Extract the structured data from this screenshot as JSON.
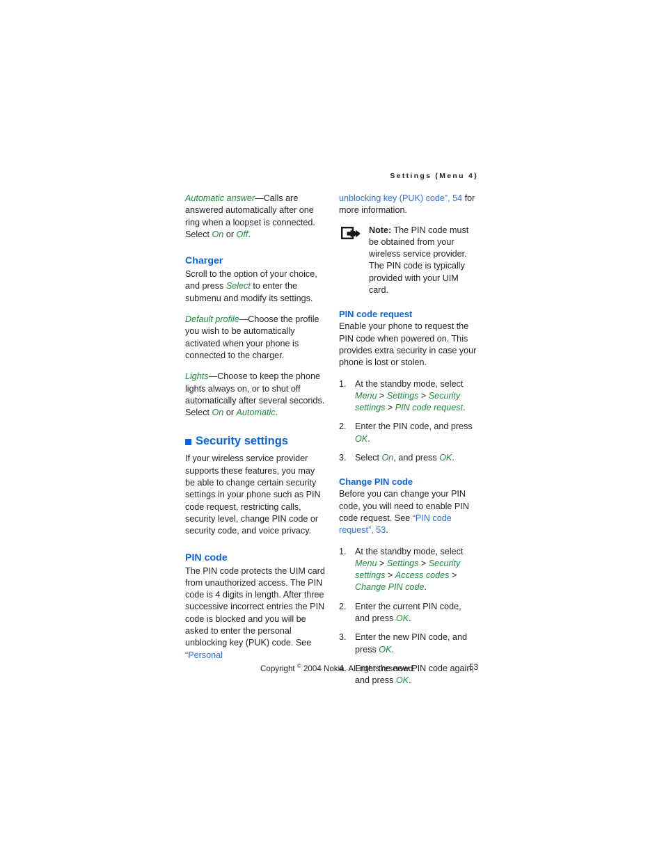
{
  "header": {
    "running_head": "Settings (Menu 4)"
  },
  "colors": {
    "heading_blue": "#0a64dc",
    "link_blue": "#2f6fd0",
    "emphasis_green": "#1d8a3e",
    "body_text": "#231f20",
    "page_background": "#ffffff"
  },
  "left_column": {
    "automatic_answer": {
      "term": "Automatic answer",
      "text_1": "—Calls are answered automatically after one ring when a loopset is connected. Select ",
      "opt_1": "On",
      "text_2": " or ",
      "opt_2": "Off",
      "text_3": "."
    },
    "charger_heading": "Charger",
    "charger_intro_1": "Scroll to the option of your choice, and press ",
    "charger_intro_em": "Select",
    "charger_intro_2": " to enter the submenu and modify its settings.",
    "default_profile": {
      "term": "Default profile",
      "text": "—Choose the profile you wish to be automatically activated when your phone is connected to the charger."
    },
    "lights": {
      "term": "Lights",
      "text_1": "—Choose to keep the phone lights always on, or to shut off automatically after several seconds. Select ",
      "opt_1": "On",
      "text_2": " or ",
      "opt_2": "Automatic",
      "text_3": "."
    },
    "security_settings_heading": "Security settings",
    "security_settings_body": "If your wireless service provider supports these features, you may be able to change certain security settings in your phone such as PIN code request, restricting calls, security level, change PIN code or security code, and voice privacy.",
    "pin_code_heading": "PIN code",
    "pin_code_body_1": "The PIN code protects the UIM card from unauthorized access. The PIN code is 4 digits in length. After three successive incorrect entries the PIN code is blocked and you will be asked to enter the personal unblocking key (PUK) code. See ",
    "pin_code_link": "“Personal"
  },
  "right_column": {
    "continuation_link": "unblocking key (PUK) code”, 54",
    "continuation_text": " for more information.",
    "note": {
      "icon": "note-hand-pointer-icon",
      "label": "Note:",
      "text": " The PIN code must be obtained from your wireless service provider. The PIN code is typically provided with your UIM card."
    },
    "pin_code_request_heading": "PIN code request",
    "pin_code_request_body": "Enable your phone to request the PIN code when powered on. This provides extra security in case your phone is lost or stolen.",
    "pin_code_request_steps": [
      {
        "prefix": "At the standby mode, select ",
        "path": [
          "Menu",
          "Settings",
          "Security settings",
          "PIN code request"
        ],
        "suffix": "."
      },
      {
        "prefix": "Enter the PIN code, and press ",
        "key": "OK",
        "suffix": "."
      },
      {
        "prefix": "Select ",
        "key": "On",
        "middle": ", and press ",
        "key2": "OK",
        "suffix": "."
      }
    ],
    "change_pin_code_heading": "Change PIN code",
    "change_pin_code_body_1": "Before you can change your PIN code, you will need to enable PIN code request. See ",
    "change_pin_code_link": "“PIN code request”, 53",
    "change_pin_code_body_2": ".",
    "change_pin_code_steps": [
      {
        "prefix": "At the standby mode, select ",
        "path": [
          "Menu",
          "Settings",
          "Security settings",
          "Access codes",
          "Change PIN code"
        ],
        "suffix": "."
      },
      {
        "prefix": "Enter the current PIN code, and press ",
        "key": "OK",
        "suffix": "."
      },
      {
        "prefix": "Enter the new PIN code, and press ",
        "key": "OK",
        "suffix": "."
      },
      {
        "prefix": "Enter the new PIN code again, and press ",
        "key": "OK",
        "suffix": "."
      }
    ]
  },
  "footer": {
    "copyright_pre": "Copyright ",
    "copyright_symbol": "©",
    "copyright_post": " 2004 Nokia. All rights reserved.",
    "page_number": "53"
  }
}
